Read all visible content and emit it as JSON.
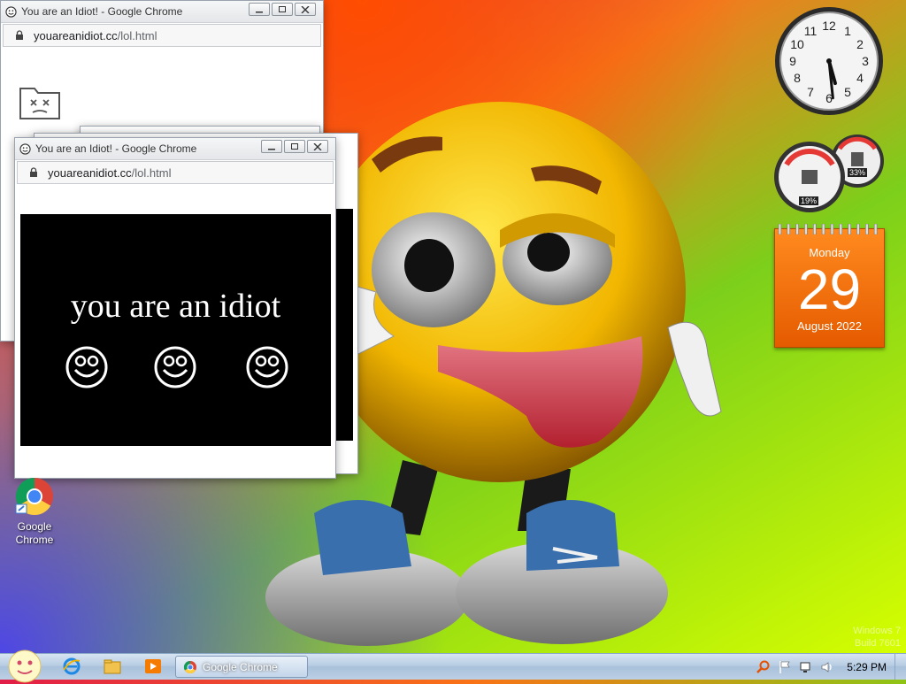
{
  "windows": {
    "back": {
      "title": "You are an Idiot! - Google Chrome",
      "url_host": "youareanidiot.cc",
      "url_path": "/lol.html"
    },
    "front": {
      "title": "You are an Idiot! - Google Chrome",
      "url_host": "youareanidiot.cc",
      "url_path": "/lol.html",
      "message": "you are an idiot"
    }
  },
  "gadgets": {
    "clock": {
      "hour": 5,
      "minute": 29
    },
    "cpu_meter": {
      "cpu_percent": "19%",
      "memory_percent": "33%"
    },
    "calendar": {
      "weekday": "Monday",
      "day": "29",
      "month_year": "August 2022"
    }
  },
  "desktop_icons": [
    {
      "label_line1": "Google",
      "label_line2": "Chrome"
    }
  ],
  "watermark": {
    "line1": "Windows 7",
    "line2": "Build 7601"
  },
  "taskbar": {
    "active_task": "Google Chrome",
    "clock": "5:29 PM"
  },
  "colors": {
    "calendar_orange": "#f07010",
    "taskbar_blue": "#b8cde3"
  }
}
